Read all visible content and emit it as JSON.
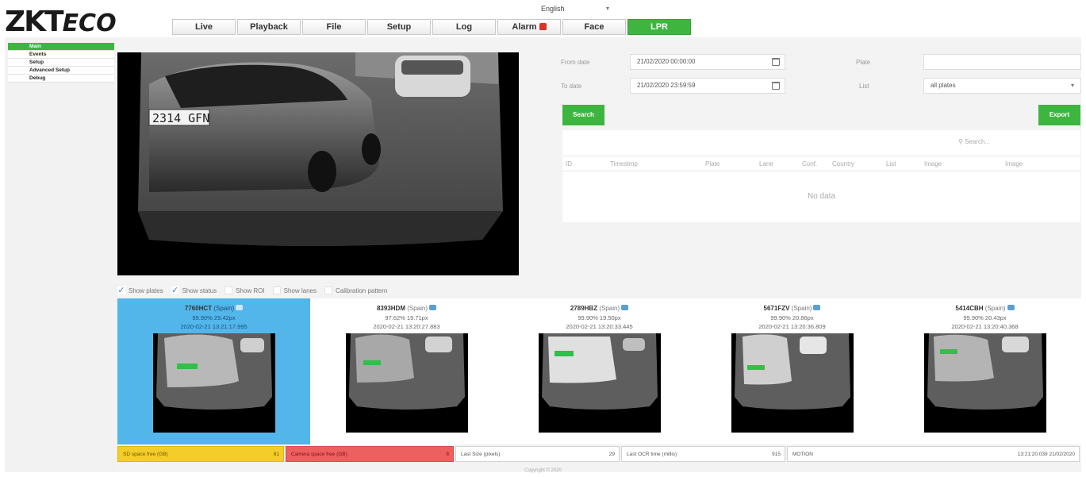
{
  "header": {
    "logo_main": "ZKT",
    "logo_eco": "ECO",
    "language": "English"
  },
  "tabs": [
    {
      "label": "Live"
    },
    {
      "label": "Playback"
    },
    {
      "label": "File"
    },
    {
      "label": "Setup"
    },
    {
      "label": "Log"
    },
    {
      "label": "Alarm"
    },
    {
      "label": "Face"
    },
    {
      "label": "LPR"
    }
  ],
  "sidebar": {
    "items": [
      {
        "label": "Main"
      },
      {
        "label": "Events"
      },
      {
        "label": "Setup"
      },
      {
        "label": "Advanced Setup"
      },
      {
        "label": "Debug"
      }
    ]
  },
  "video": {
    "plate_text": "2314 GFN"
  },
  "filters": {
    "from_label": "From date",
    "from_value": "21/02/2020 00:00:00",
    "to_label": "To date",
    "to_value": "21/02/2020 23:59:59",
    "plate_label": "Plate",
    "plate_value": "",
    "list_label": "List",
    "list_value": "all plates",
    "search_button": "Search",
    "export_button": "Export"
  },
  "results": {
    "search_placeholder": "Search...",
    "columns": [
      "ID",
      "Timestmp",
      "Plate",
      "Lane",
      "Conf.",
      "Country",
      "List",
      "Image",
      "Image"
    ],
    "empty_text": "No data"
  },
  "options": [
    {
      "label": "Show plates",
      "checked": true
    },
    {
      "label": "Show status",
      "checked": true
    },
    {
      "label": "Show ROI",
      "checked": false
    },
    {
      "label": "Show lanes",
      "checked": false
    },
    {
      "label": "Calibration pattern",
      "checked": false
    }
  ],
  "recent": [
    {
      "plate": "7760HCT",
      "country": "(Spain)",
      "conf": "99.90% 29.42px",
      "time": "2020-02-21 13:21:17.995",
      "selected": true
    },
    {
      "plate": "8393HDM",
      "country": "(Spain)",
      "conf": "97.62% 19.71px",
      "time": "2020-02-21 13:20:27.883",
      "selected": false
    },
    {
      "plate": "2789HBZ",
      "country": "(Spain)",
      "conf": "99.90% 19.50px",
      "time": "2020-02-21 13:20:33.445",
      "selected": false
    },
    {
      "plate": "5671FZV",
      "country": "(Spain)",
      "conf": "99.90% 20.86px",
      "time": "2020-02-21 13:20:36.809",
      "selected": false
    },
    {
      "plate": "5414CBH",
      "country": "(Spain)",
      "conf": "99.90% 20.43px",
      "time": "2020-02-21 13:20:40.368",
      "selected": false
    }
  ],
  "status": {
    "sd_label": "SD space free (GB)",
    "sd_value": "81",
    "cam_label": "Camera space free (GB)",
    "cam_value": "8",
    "plate_size_label": "Last Size (pixels)",
    "plate_size_value": "29",
    "ocr_label": "Last OCR time (millis)",
    "ocr_value": "915",
    "motion_label": "MOTION",
    "datetime": "13:21:20.039 21/02/2020"
  },
  "footer": {
    "copyright": "Copyright © 2020"
  }
}
